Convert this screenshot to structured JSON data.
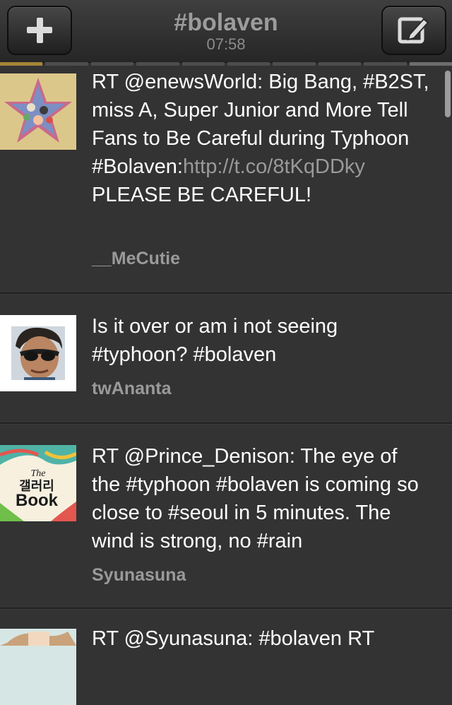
{
  "header": {
    "title": "#bolaven",
    "time": "07:58"
  },
  "pager": {
    "count": 10,
    "active_index": 0
  },
  "tweets": [
    {
      "text_before": "RT @enewsWorld: Big Bang, #B2ST, miss A, Super Junior and More Tell Fans to Be Careful during Typhoon #Bolaven:",
      "link": "http://t.co/8tKqDDky",
      "text_after": " PLEASE BE CAREFUL!",
      "user": "__MeCutie",
      "avatar": "star-collage-avatar"
    },
    {
      "text": "Is it over or am i not seeing #typhoon? #bolaven",
      "user": "twAnanta",
      "avatar": "sunglasses-portrait-avatar"
    },
    {
      "text": "RT @Prince_Denison: The eye of the #typhoon #bolaven is coming so close to #seoul in 5 minutes. The wind is strong, no #rain",
      "user": "Syunasuna",
      "avatar": "gallery-book-avatar",
      "avatar_text": {
        "small": "The",
        "korean": "갤러리",
        "big": "Book"
      }
    },
    {
      "text": "RT @Syunasuna: #bolaven RT",
      "avatar": "photo-avatar"
    }
  ]
}
